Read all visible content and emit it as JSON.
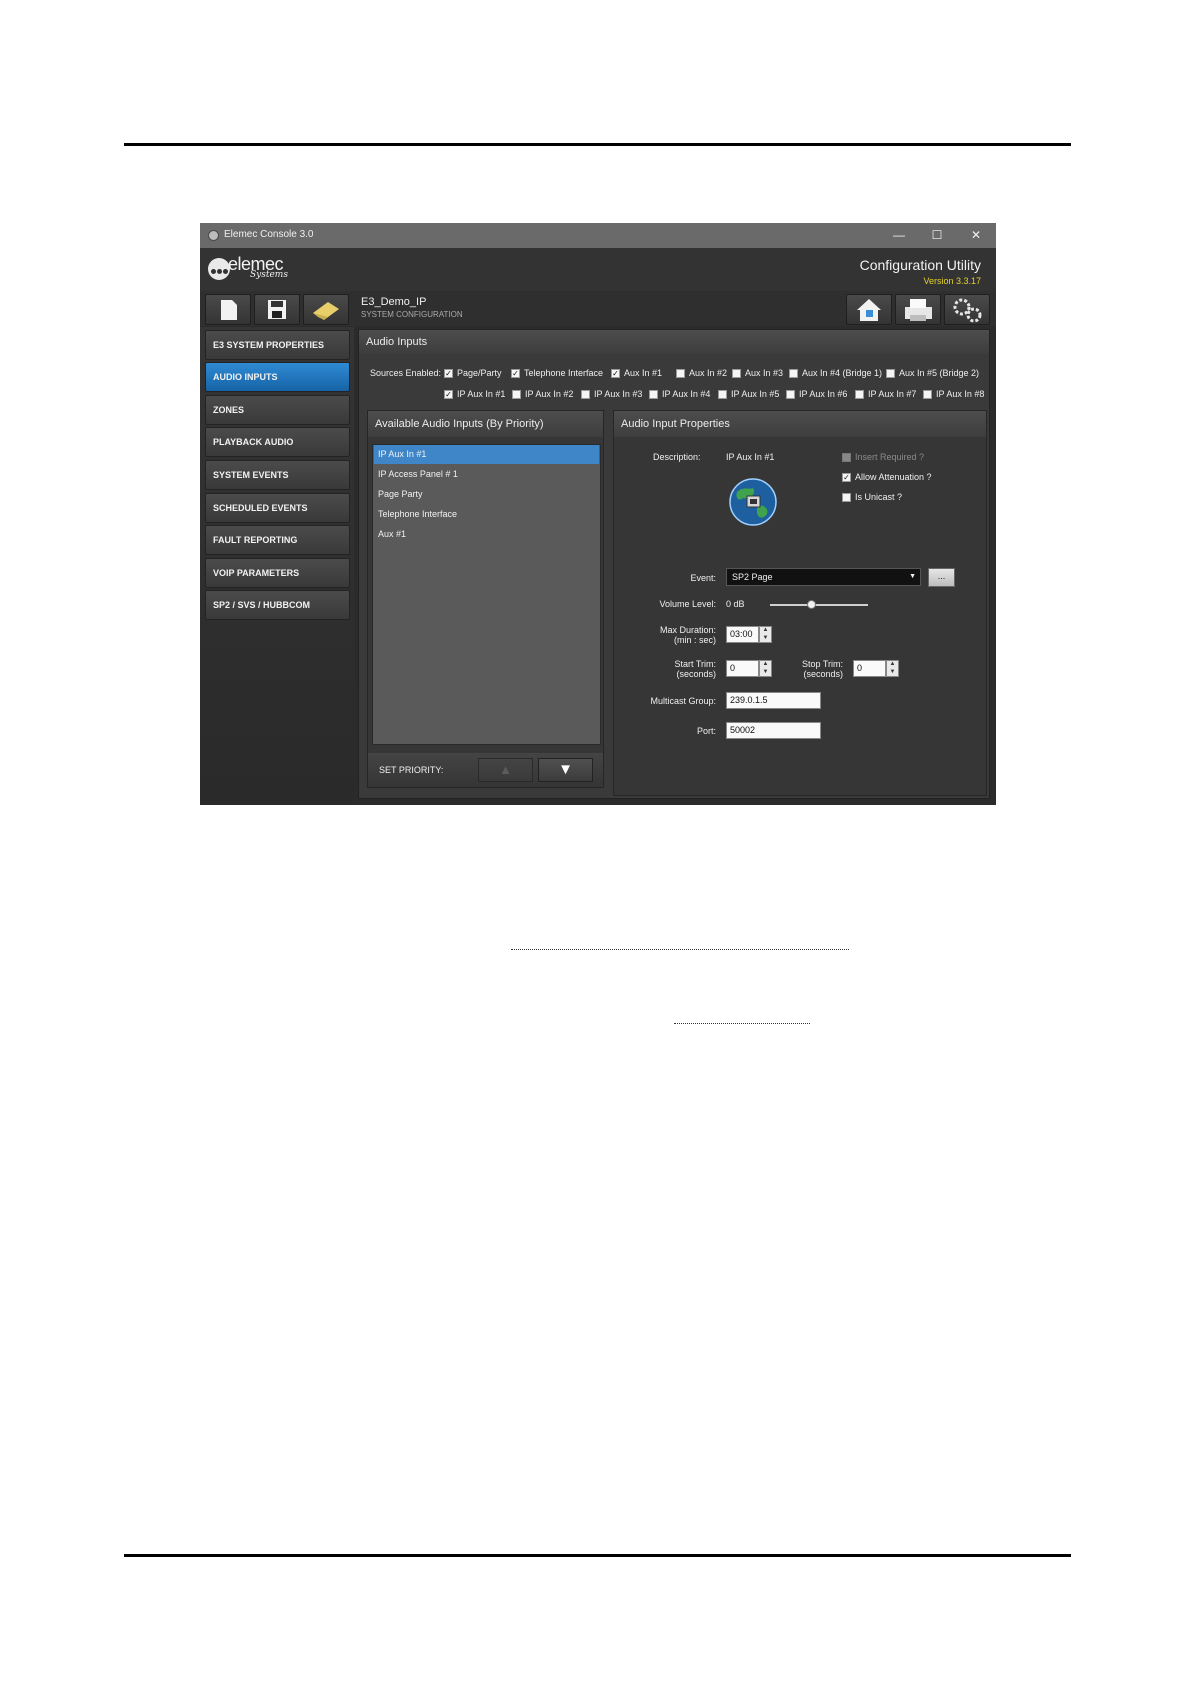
{
  "window": {
    "title": "Elemec Console 3.0",
    "minimize": "—",
    "maximize": "☐",
    "close": "✕"
  },
  "header": {
    "logo_text": "elemec",
    "logo_sub": "Systems",
    "title": "Configuration Utility",
    "version": "Version 3.3.17"
  },
  "toolbar": {
    "project_name": "E3_Demo_IP",
    "project_sub": "SYSTEM CONFIGURATION",
    "icons": [
      "new-file-icon",
      "save-icon",
      "eraser-icon",
      "home-icon",
      "printer-icon",
      "settings-icon"
    ]
  },
  "nav": {
    "items": [
      {
        "label": "E3 SYSTEM PROPERTIES"
      },
      {
        "label": "AUDIO INPUTS"
      },
      {
        "label": "ZONES"
      },
      {
        "label": "PLAYBACK AUDIO"
      },
      {
        "label": "SYSTEM EVENTS"
      },
      {
        "label": "SCHEDULED EVENTS"
      },
      {
        "label": "FAULT REPORTING"
      },
      {
        "label": "VOIP PARAMETERS"
      },
      {
        "label": "SP2 / SVS / HUBBCOM"
      }
    ]
  },
  "main": {
    "section_title": "Audio Inputs",
    "sources_label": "Sources Enabled:",
    "sources_row1": [
      {
        "label": "Page/Party",
        "checked": true
      },
      {
        "label": "Telephone Interface",
        "checked": true
      },
      {
        "label": "Aux In #1",
        "checked": true
      },
      {
        "label": "Aux In #2",
        "checked": false
      },
      {
        "label": "Aux In #3",
        "checked": false
      },
      {
        "label": "Aux In #4 (Bridge 1)",
        "checked": false
      },
      {
        "label": "Aux In #5 (Bridge 2)",
        "checked": false
      }
    ],
    "sources_row2": [
      {
        "label": "IP Aux In #1",
        "checked": true
      },
      {
        "label": "IP Aux In #2",
        "checked": false
      },
      {
        "label": "IP Aux In #3",
        "checked": false
      },
      {
        "label": "IP Aux In #4",
        "checked": false
      },
      {
        "label": "IP Aux In #5",
        "checked": false
      },
      {
        "label": "IP Aux In #6",
        "checked": false
      },
      {
        "label": "IP Aux In #7",
        "checked": false
      },
      {
        "label": "IP Aux In #8",
        "checked": false
      }
    ],
    "available": {
      "title": "Available Audio Inputs (By Priority)",
      "items": [
        "IP Aux In #1",
        "IP Access Panel # 1",
        "Page Party",
        "Telephone Interface",
        "Aux #1"
      ],
      "set_priority": "SET PRIORITY:",
      "up": "▲",
      "down": "▼"
    },
    "properties": {
      "title": "Audio Input Properties",
      "description_label": "Description:",
      "description_value": "IP Aux In #1",
      "insert_required": "Insert Required ?",
      "allow_attenuation": "Allow Attenuation ?",
      "is_unicast": "Is Unicast ?",
      "checks": {
        "insert_required": false,
        "allow_attenuation": true,
        "is_unicast": false
      },
      "event_label": "Event:",
      "event_value": "SP2 Page",
      "event_more": "...",
      "volume_label": "Volume Level:",
      "volume_value": "0 dB",
      "max_duration_label_1": "Max Duration:",
      "max_duration_label_2": "(min : sec)",
      "max_duration_value": "03:00",
      "start_trim_label_1": "Start Trim:",
      "start_trim_label_2": "(seconds)",
      "start_trim_value": "0",
      "stop_trim_label_1": "Stop Trim:",
      "stop_trim_label_2": "(seconds)",
      "stop_trim_value": "0",
      "multicast_label": "Multicast Group:",
      "multicast_value": "239.0.1.5",
      "port_label": "Port:",
      "port_value": "50002"
    }
  }
}
